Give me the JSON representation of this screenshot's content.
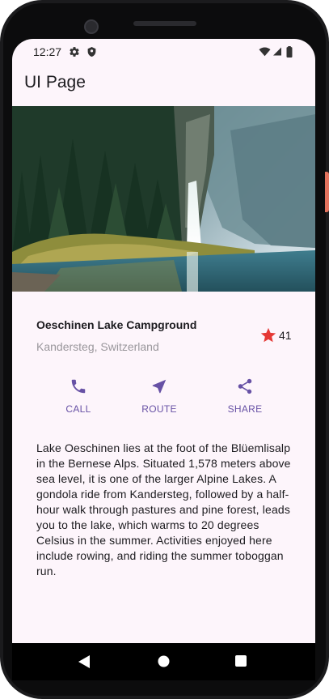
{
  "status_bar": {
    "time": "12:27",
    "icons": [
      "gear-icon",
      "shield-icon",
      "wifi-icon",
      "signal-icon",
      "battery-icon"
    ]
  },
  "app_bar": {
    "title": "UI Page"
  },
  "hero_image": {
    "subject": "alpine lake with waterfall and pine forest"
  },
  "place": {
    "title": "Oeschinen Lake Campground",
    "location": "Kandersteg, Switzerland",
    "rating_count": "41",
    "star_color": "#e53935"
  },
  "actions": [
    {
      "label": "CALL",
      "icon": "phone-icon"
    },
    {
      "label": "ROUTE",
      "icon": "navigation-icon"
    },
    {
      "label": "SHARE",
      "icon": "share-icon"
    }
  ],
  "accent_color": "#6751a5",
  "description": "Lake Oeschinen lies at the foot of the Blüemlisalp in the Bernese Alps. Situated 1,578 meters above sea level, it is one of the larger Alpine Lakes. A gondola ride from Kandersteg, followed by a half-hour walk through pastures and pine forest, leads you to the lake, which warms to 20 degrees Celsius in the summer. Activities enjoyed here include rowing, and riding the summer toboggan run.",
  "nav_bar": {
    "buttons": [
      "back-icon",
      "home-icon",
      "recents-icon"
    ]
  }
}
